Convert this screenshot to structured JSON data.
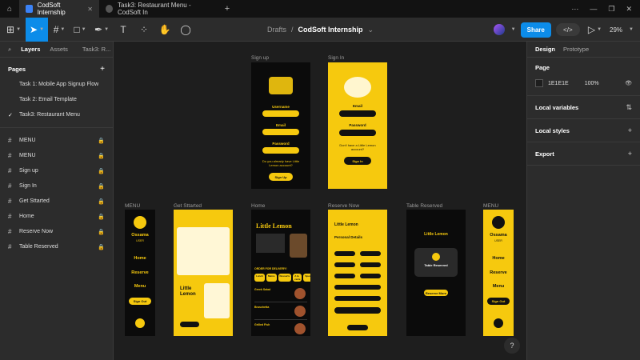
{
  "browser": {
    "active_tab": "CodSoft Internship",
    "inactive_tab": "Task3: Restaurant Menu - CodSoft In"
  },
  "toolbar": {
    "breadcrumb_parent": "Drafts",
    "breadcrumb_sep": "/",
    "file_name": "CodSoft Internship",
    "share_label": "Share",
    "zoom": "29%"
  },
  "left_panel": {
    "tabs": [
      "Layers",
      "Assets"
    ],
    "current_page_tab": "Task3: R...",
    "pages_header": "Pages",
    "pages": [
      {
        "label": "Task 1: Mobile App Signup Flow",
        "current": false
      },
      {
        "label": "Task 2: Email Template",
        "current": false
      },
      {
        "label": "Task3: Restaurant Menu",
        "current": true
      }
    ],
    "layers": [
      "MENU",
      "MENU",
      "Sign up",
      "Sign In",
      "Get Sttarted",
      "Home",
      "Reserve Now",
      "Table Reserved"
    ]
  },
  "canvas": {
    "labels": {
      "sign_up": "Sign up",
      "sign_in": "Sign In",
      "menu_left": "MENU",
      "get_started": "Get Sttarted",
      "home": "Home",
      "reserve_now": "Reserve Now",
      "table_reserved": "Table Reserved",
      "menu_right": "MENU"
    },
    "signup": {
      "username": "Username",
      "email": "Email",
      "password": "Password",
      "already": "Do you already have Little Lemon account?",
      "button": "Sign Up"
    },
    "signin": {
      "email": "Email",
      "password": "Password",
      "no_account": "Don't have a Little Lemon account?",
      "button": "Sign In"
    },
    "menu": {
      "name": "Ossama",
      "sub": "USER",
      "items": [
        "Home",
        "Reserve",
        "Menu"
      ],
      "sign_out": "Sign Out"
    },
    "get_started": {
      "title": "Little Lemon"
    },
    "home": {
      "title": "Little Lemon",
      "order": "ORDER FOR DELIVERY!",
      "chips": [
        "Lunch",
        "Mains",
        "Desserts",
        "A la carte",
        "Specials"
      ],
      "dishes": [
        "Greek Salad",
        "Bruschetta",
        "Grilled Fish"
      ]
    },
    "reserve": {
      "title": "Little Lemon",
      "section": "Personal Details",
      "button": "Reserve"
    },
    "table_reserved": {
      "title": "Little Lemon",
      "card_title": "Table Reserved",
      "button": "Reserve More"
    },
    "help": "?"
  },
  "right_panel": {
    "tabs": [
      "Design",
      "Prototype"
    ],
    "page_title": "Page",
    "page_color": "1E1E1E",
    "page_opacity": "100%",
    "local_variables": "Local variables",
    "local_styles": "Local styles",
    "export": "Export"
  },
  "colors": {
    "accent": "#0c8ce9",
    "yellow": "#f6c90e",
    "canvas_bg": "#1e1e1e",
    "panel_bg": "#2c2c2c"
  }
}
